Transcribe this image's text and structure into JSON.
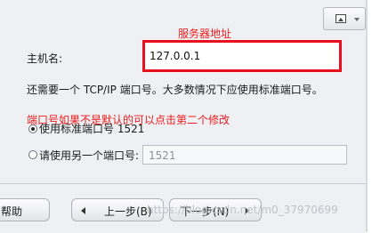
{
  "annotations": {
    "server_address": "服务器地址",
    "port_note": "端口号如果不是默认的可以点击第二个修改"
  },
  "host": {
    "label": "主机名:",
    "value": "127.0.0.1"
  },
  "port_instruction": "还需要一个 TCP/IP 端口号。大多数情况下应使用标准端口号。",
  "port_options": {
    "standard_label": "使用标准端口号 1521",
    "standard_selected": true,
    "custom_label": "请使用另一个端口号:",
    "custom_value": "1521"
  },
  "buttons": {
    "help": "帮助",
    "back": "上一步(B)",
    "next": "下一步(N)"
  },
  "watermark": "https://blog.csdn.net/m0_37970699",
  "toolbar": {
    "image_icon": "image-icon",
    "dropdown_icon": "chevron-down-icon"
  },
  "colors": {
    "annotation_red": "#ee1c1c",
    "highlight_border": "#e8101d",
    "panel_bg": "#eef0f3"
  }
}
